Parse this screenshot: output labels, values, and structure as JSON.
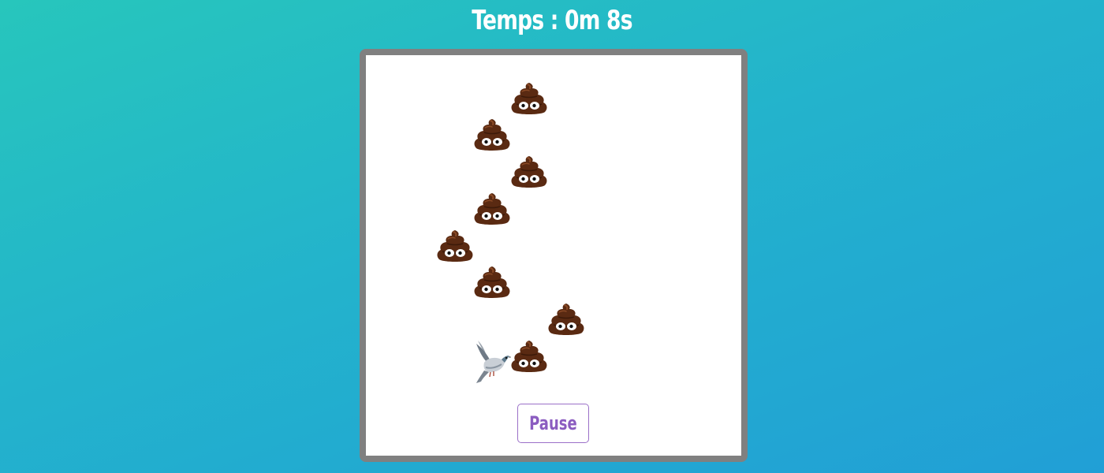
{
  "header": {
    "timer_label": "Temps : 0m 8s"
  },
  "board": {
    "pause_label": "Pause",
    "player": {
      "icon": "pigeon-icon",
      "col": 3,
      "row": 8
    },
    "trail": [
      {
        "icon": "poop-icon",
        "col": 4,
        "row": 1
      },
      {
        "icon": "poop-icon",
        "col": 3,
        "row": 2
      },
      {
        "icon": "poop-icon",
        "col": 4,
        "row": 3
      },
      {
        "icon": "poop-icon",
        "col": 3,
        "row": 4
      },
      {
        "icon": "poop-icon",
        "col": 2,
        "row": 5
      },
      {
        "icon": "poop-icon",
        "col": 3,
        "row": 6
      },
      {
        "icon": "poop-icon",
        "col": 5,
        "row": 7
      },
      {
        "icon": "poop-icon",
        "col": 4,
        "row": 8
      }
    ]
  },
  "colors": {
    "gradient_start": "#27c6bc",
    "gradient_end": "#219fd6",
    "board_border": "#808080",
    "button_text": "#8b5cc0",
    "poop": "#5a2a12"
  }
}
